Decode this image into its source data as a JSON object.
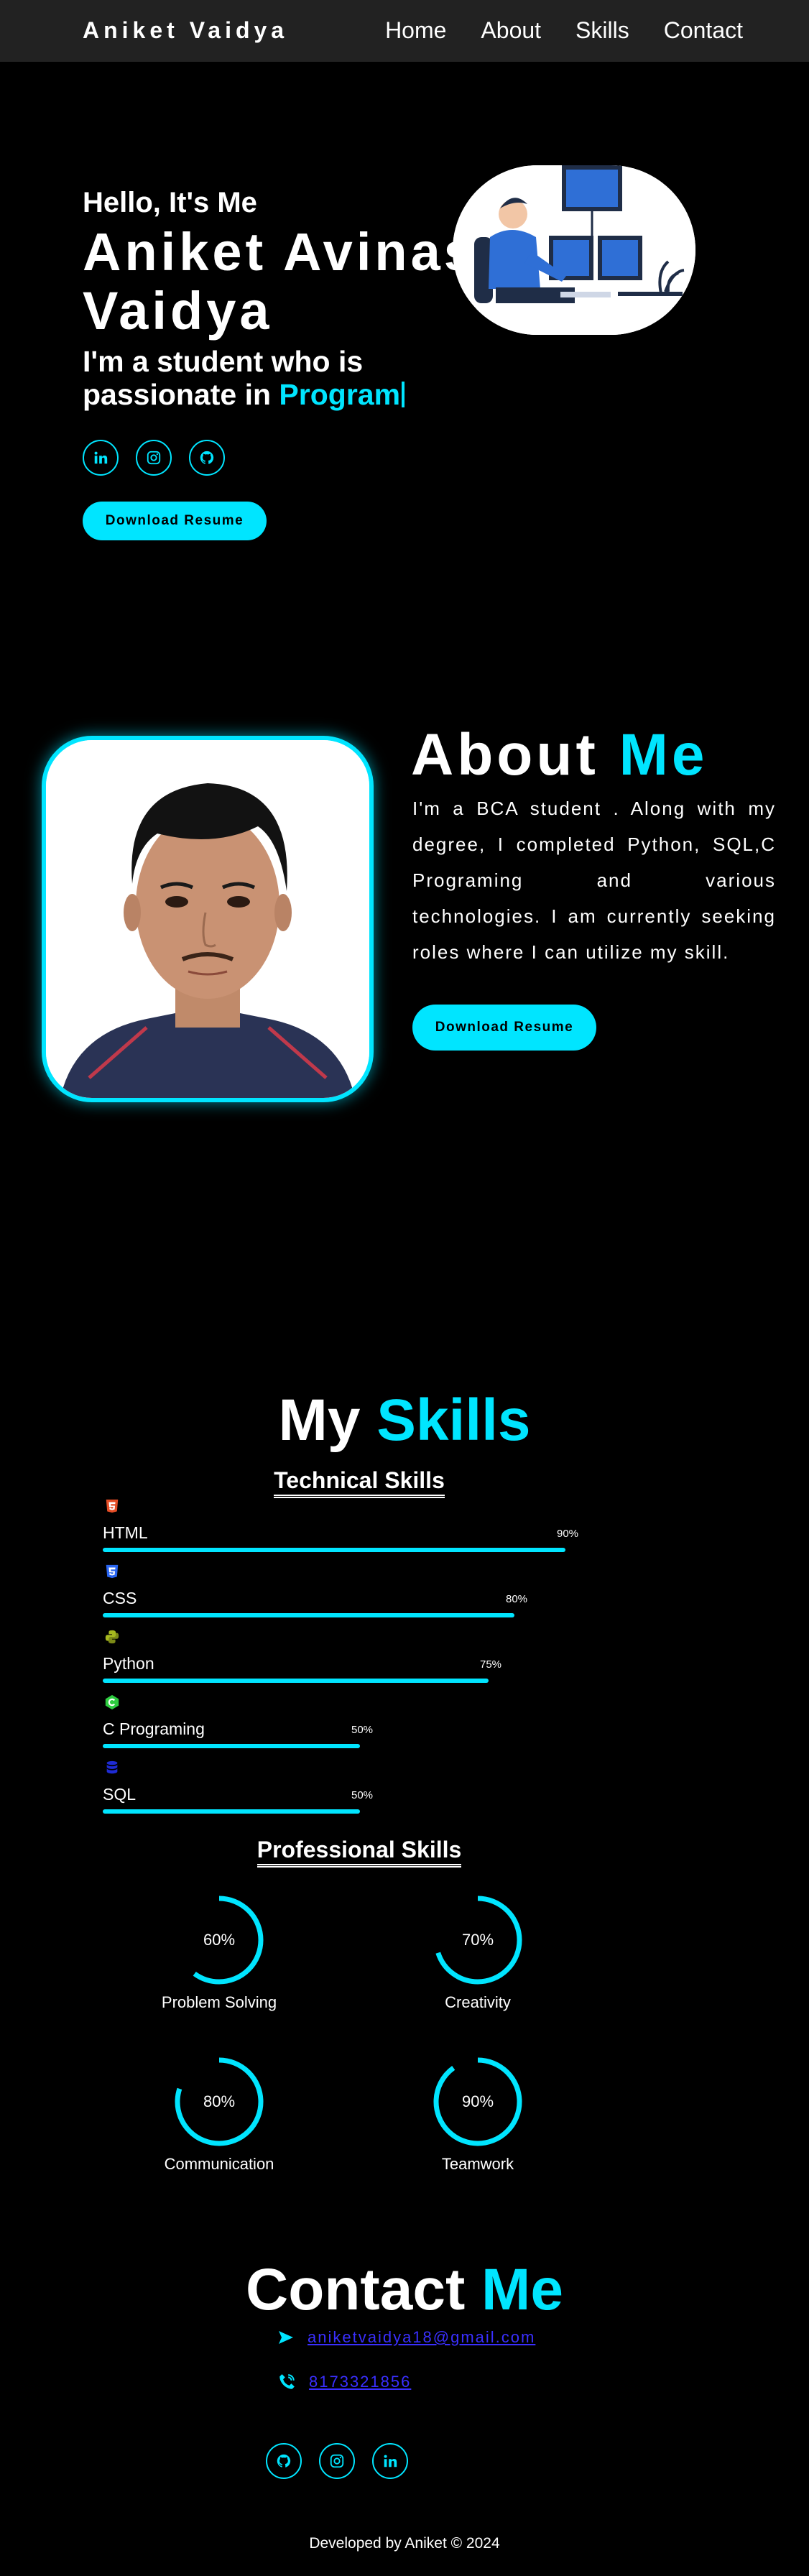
{
  "nav": {
    "brand": "Aniket Vaidya",
    "links": [
      "Home",
      "About",
      "Skills",
      "Contact"
    ]
  },
  "hero": {
    "greeting": "Hello, It's Me",
    "name_line1": "Aniket Avinash",
    "name_line2": "Vaidya",
    "tagline_prefix": "I'm a student who is passionate in ",
    "tagline_typed": "Program",
    "resume_button": "Download Resume",
    "socials": [
      "linkedin-icon",
      "instagram-icon",
      "github-icon"
    ]
  },
  "about": {
    "title_main": "About",
    "title_accent": "Me",
    "text": "I'm a BCA student . Along with my degree, I completed Python, SQL,C Programing and various technologies. I am currently seeking roles where I can utilize my skill.",
    "resume_button": "Download Resume"
  },
  "skills": {
    "title_main": "My",
    "title_accent": "Skills",
    "technical_title": "Technical Skills",
    "technical": [
      {
        "name": "HTML",
        "percent": 90,
        "label": "90%",
        "icon": "html5-icon",
        "color": "#e44d26"
      },
      {
        "name": "CSS",
        "percent": 80,
        "label": "80%",
        "icon": "css3-icon",
        "color": "#2965f1"
      },
      {
        "name": "Python",
        "percent": 75,
        "label": "75%",
        "icon": "python-icon",
        "color": "#a6b81f"
      },
      {
        "name": "C Programing",
        "percent": 50,
        "label": "50%",
        "icon": "c-hexagon-icon",
        "color": "#2ecc40"
      },
      {
        "name": "SQL",
        "percent": 50,
        "label": "50%",
        "icon": "database-icon",
        "color": "#1e2bd4"
      }
    ],
    "professional_title": "Professional Skills",
    "professional": [
      {
        "name": "Problem Solving",
        "percent": 60,
        "label": "60%"
      },
      {
        "name": "Creativity",
        "percent": 70,
        "label": "70%"
      },
      {
        "name": "Communication",
        "percent": 80,
        "label": "80%"
      },
      {
        "name": "Teamwork",
        "percent": 90,
        "label": "90%"
      }
    ]
  },
  "contact": {
    "title_main": "Contact",
    "title_accent": "Me",
    "email": "aniketvaidya18@gmail.com",
    "phone": "8173321856",
    "socials": [
      "github-icon",
      "instagram-icon",
      "linkedin-icon"
    ]
  },
  "footer": {
    "text": "Developed by Aniket © 2024"
  },
  "colors": {
    "accent": "#00e5ff",
    "background": "#000000",
    "navbar": "#222222",
    "link": "#3a2fff"
  }
}
